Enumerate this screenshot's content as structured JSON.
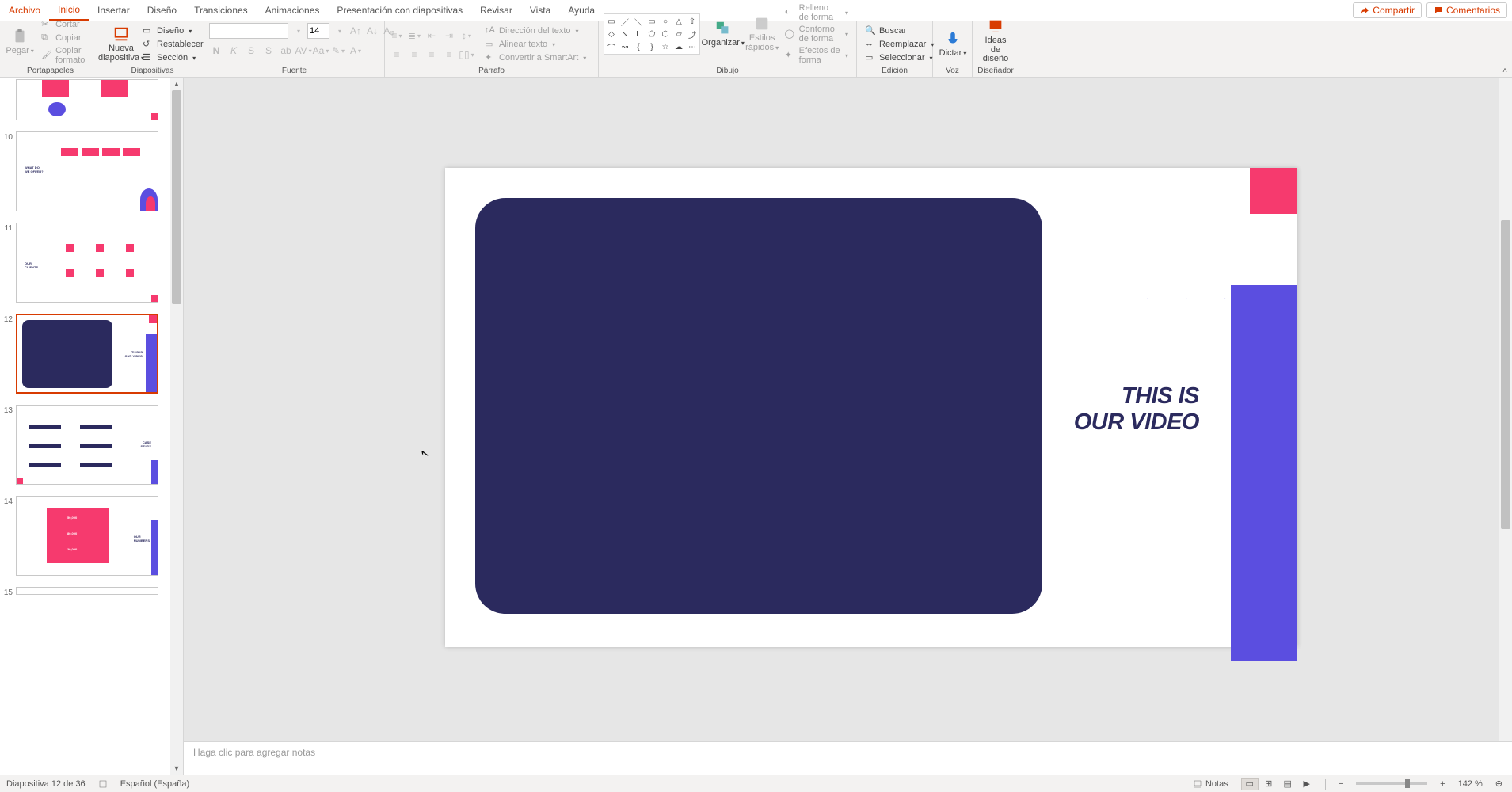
{
  "menubar": {
    "tabs": [
      "Archivo",
      "Inicio",
      "Insertar",
      "Diseño",
      "Transiciones",
      "Animaciones",
      "Presentación con diapositivas",
      "Revisar",
      "Vista",
      "Ayuda"
    ],
    "active": "Inicio",
    "share": "Compartir",
    "comments": "Comentarios"
  },
  "ribbon": {
    "clipboard": {
      "label": "Portapapeles",
      "paste": "Pegar",
      "cut": "Cortar",
      "copy": "Copiar",
      "format": "Copiar formato"
    },
    "slides": {
      "label": "Diapositivas",
      "new": "Nueva\ndiapositiva",
      "layout": "Diseño",
      "reset": "Restablecer",
      "section": "Sección"
    },
    "font": {
      "label": "Fuente",
      "name": "",
      "size": "14"
    },
    "paragraph": {
      "label": "Párrafo",
      "textdir": "Dirección del texto",
      "align": "Alinear texto",
      "smartart": "Convertir a SmartArt"
    },
    "drawing": {
      "label": "Dibujo",
      "arrange": "Organizar",
      "quick": "Estilos\nrápidos",
      "fill": "Relleno de forma",
      "outline": "Contorno de forma",
      "effects": "Efectos de forma"
    },
    "editing": {
      "label": "Edición",
      "find": "Buscar",
      "replace": "Reemplazar",
      "select": "Seleccionar"
    },
    "voice": {
      "label": "Voz",
      "dictate": "Dictar"
    },
    "designer": {
      "label": "Diseñador",
      "ideas": "Ideas de\ndiseño"
    }
  },
  "thumbnails": {
    "items": [
      {
        "num": "",
        "style": "s9"
      },
      {
        "num": "10",
        "style": "s10"
      },
      {
        "num": "11",
        "style": "s11"
      },
      {
        "num": "12",
        "style": "s12",
        "active": true
      },
      {
        "num": "13",
        "style": "s13"
      },
      {
        "num": "14",
        "style": "s14"
      },
      {
        "num": "15",
        "style": "s15"
      }
    ]
  },
  "slide": {
    "title_line1": "THIS IS",
    "title_line2": "OUR VIDEO"
  },
  "notes": {
    "placeholder": "Haga clic para agregar notas"
  },
  "status": {
    "slide_counter": "Diapositiva 12 de 36",
    "language": "Español (España)",
    "notes": "Notas",
    "zoom": "142 %"
  }
}
